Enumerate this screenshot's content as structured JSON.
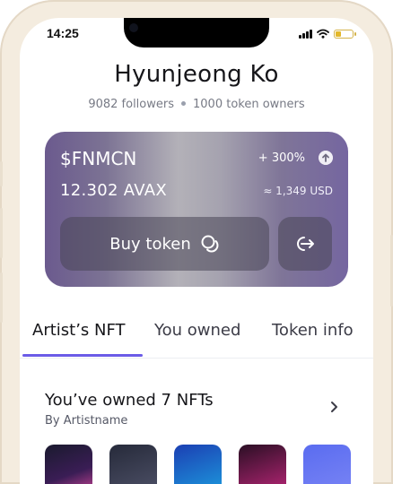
{
  "status_bar": {
    "time": "14:25"
  },
  "profile": {
    "name": "Hyunjeong Ko",
    "followers": "9082 followers",
    "token_owners": "1000 token owners"
  },
  "token": {
    "symbol": "$FNMCN",
    "change": "+ 300%",
    "price": "12.302 AVAX",
    "usd": "≈ 1,349 USD",
    "buy_label": "Buy token"
  },
  "tabs": [
    {
      "label": "Artist’s NFT",
      "active": true
    },
    {
      "label": "You owned",
      "active": false
    },
    {
      "label": "Token info",
      "active": false
    }
  ],
  "owned": {
    "title": "You’ve owned 7 NFTs",
    "subtitle": "By Artistname"
  },
  "colors": {
    "accent": "#6b5ce7",
    "battery": "#e3b729"
  }
}
